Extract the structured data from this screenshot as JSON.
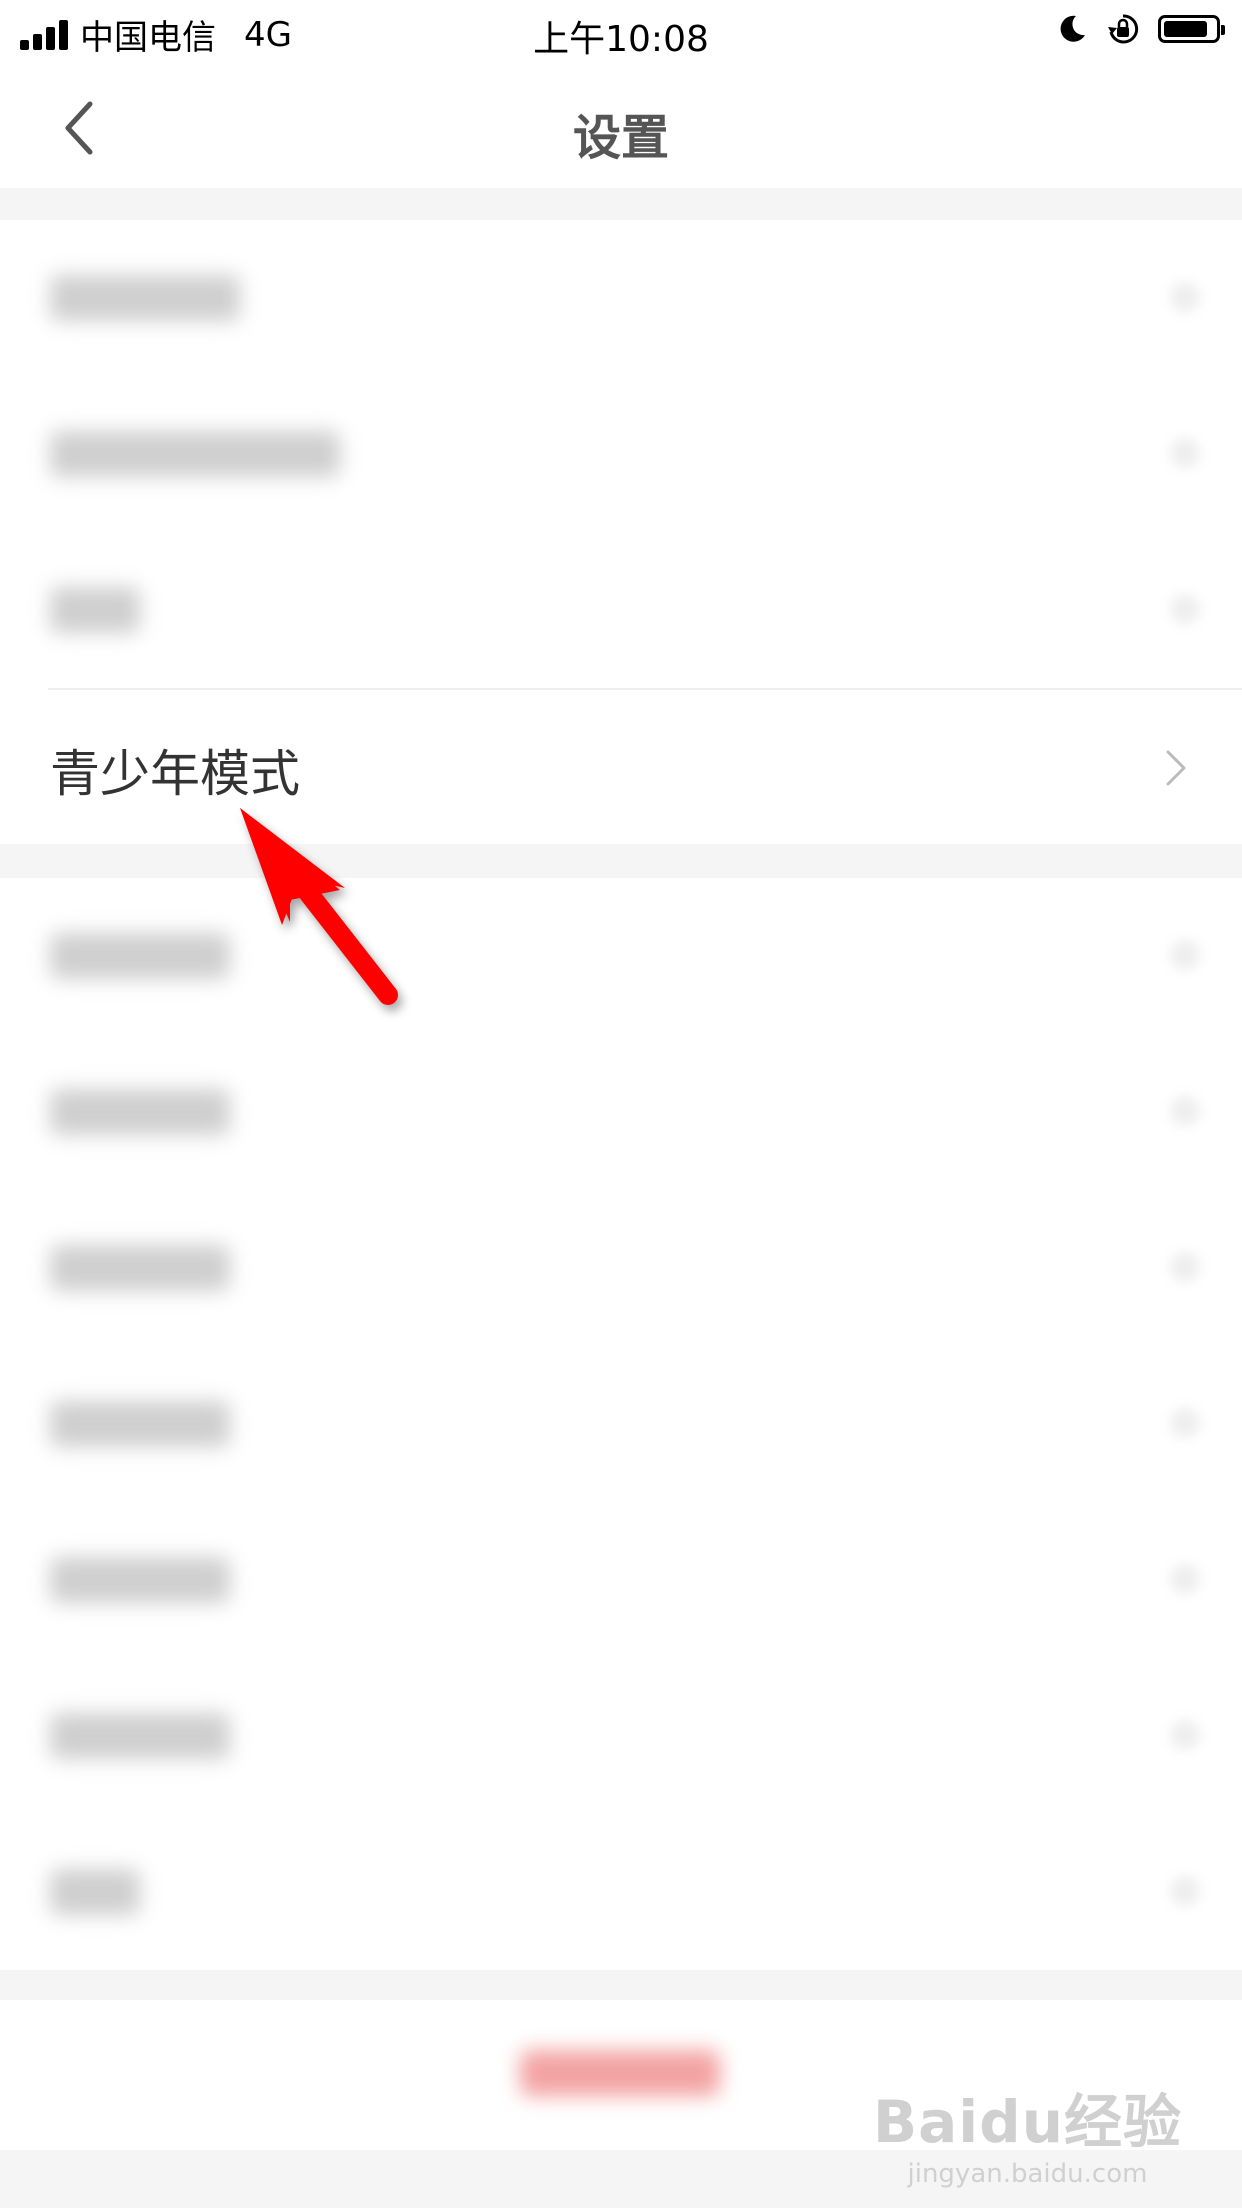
{
  "status_bar": {
    "carrier": "中国电信",
    "network": "4G",
    "time": "上午10:08"
  },
  "header": {
    "title": "设置",
    "back_icon": "chevron-left-icon"
  },
  "settings": {
    "highlighted_item": {
      "label": "青少年模式",
      "chevron_icon": "chevron-right-icon"
    }
  },
  "watermark": {
    "brand": "Baidu经验",
    "url": "jingyan.baidu.com"
  },
  "colors": {
    "annotation_arrow": "#ff0000",
    "background": "#f5f5f5"
  }
}
